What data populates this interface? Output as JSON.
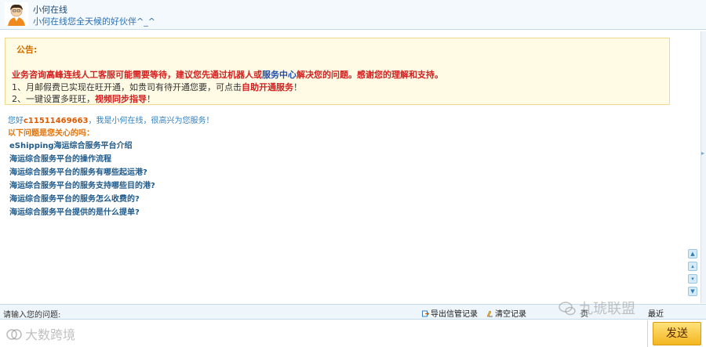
{
  "header": {
    "bot_name": "小何在线",
    "bot_status": "小何在线您全天候的好伙伴^_^"
  },
  "notice": {
    "title": "公告:",
    "main_part1": "业务咨询高峰连线人工客服可能需要等待，建议您先通过机器人或",
    "main_link": "服务中心",
    "main_part2": "解决您的问题。感谢您的理解和支持。",
    "line1_prefix": "1、月邮假费已实现在旺开通，如贵司有待开通您要，可点击",
    "line1_link": "自助开通服务",
    "line1_suffix": "！",
    "line2_prefix": "2、一键设置多旺旺，",
    "line2_link": "视频同步指导",
    "line2_suffix": "！"
  },
  "greeting": {
    "prefix": "您好",
    "account": "c11511469663",
    "suffix": "，我是小何在线，很高兴为您服务！"
  },
  "faq": {
    "heading": "以下问题是您关心的吗：",
    "items": [
      "eShipping海运综合服务平台介绍",
      "海运综合服务平台的操作流程",
      "海运综合服务平台的服务有哪些起运港?",
      "海运综合服务平台的服务支持哪些目的港?",
      "海运综合服务平台的服务怎么收费的?",
      "海运综合服务平台提供的是什么提单?"
    ]
  },
  "input_bar": {
    "label": "请输入您的问题:",
    "tools": [
      "导出信管记录",
      "清空记录",
      "页",
      "最近"
    ]
  },
  "compose": {
    "placeholder": ""
  },
  "send_label": "发送",
  "watermarks": {
    "left": "大数跨境",
    "right": "九琥联盟"
  },
  "icons": [
    "avatar-icon",
    "export-icon",
    "clear-icon",
    "chevron-right-icon",
    "arrow-up-icon",
    "arrow-down-icon"
  ],
  "colors": {
    "accent": "#2b6fb0",
    "notice_red": "#d32020",
    "send_btn": "#f3b620"
  }
}
